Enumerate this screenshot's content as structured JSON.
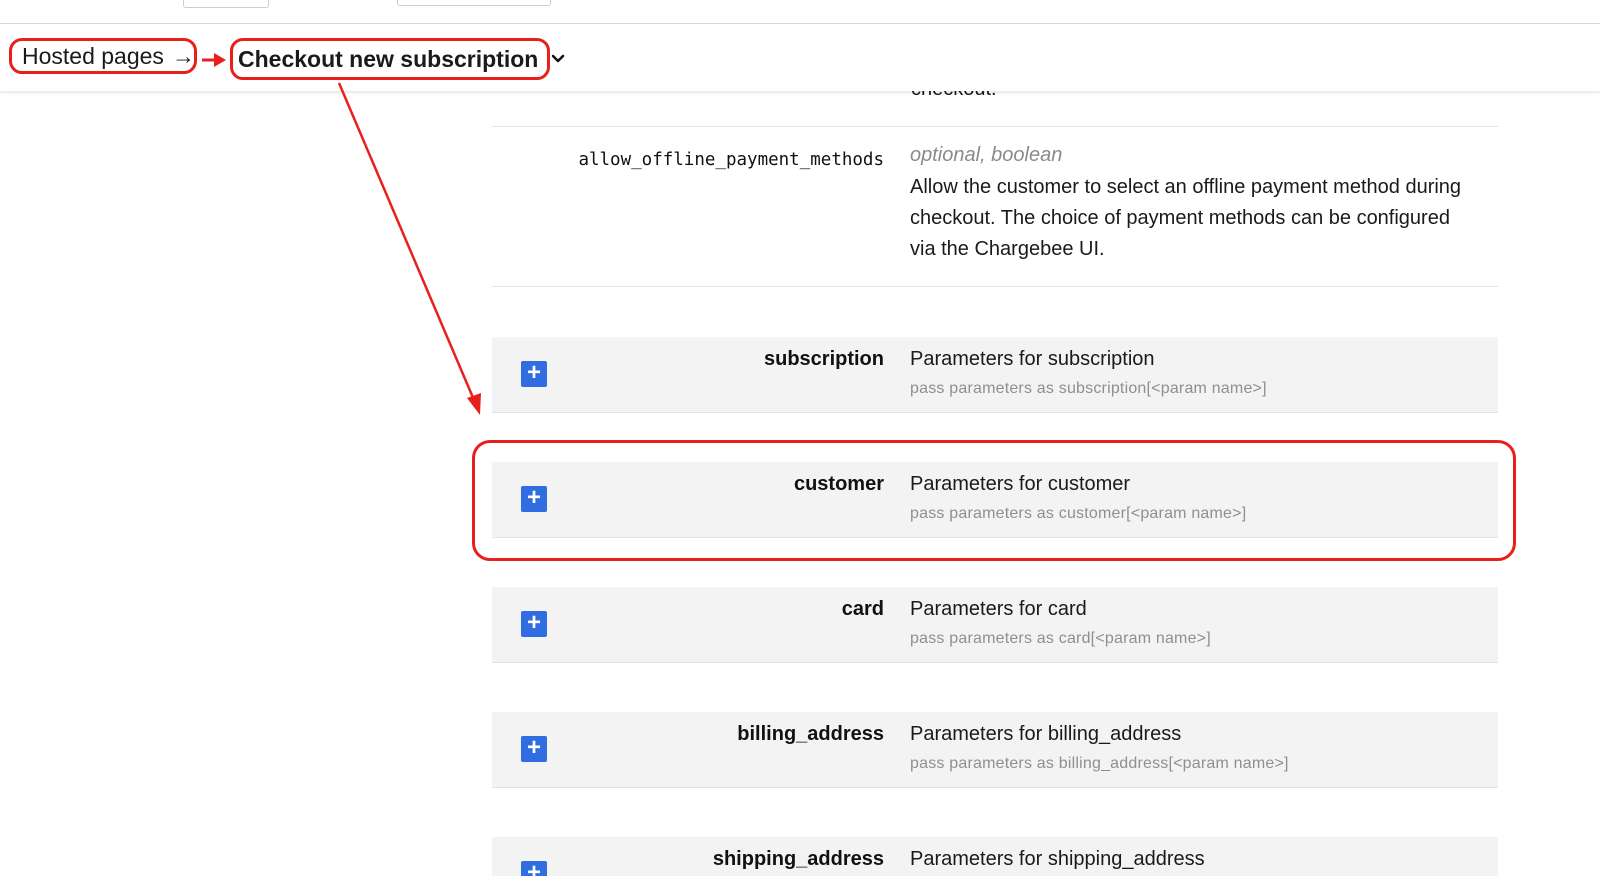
{
  "breadcrumb": {
    "parent_label": "Hosted pages",
    "parent_arrow": "→",
    "current_label": "Checkout new subscription"
  },
  "content": {
    "truncated_text": "checkout.",
    "param": {
      "name": "allow_offline_payment_methods",
      "meta": "optional, boolean",
      "description": "Allow the customer to select an offline payment method during checkout. The choice of payment methods can be configured via the Chargebee UI."
    },
    "groups": [
      {
        "name": "subscription",
        "description": "Parameters for subscription",
        "hint": "pass parameters as subscription[<param name>]"
      },
      {
        "name": "customer",
        "description": "Parameters for customer",
        "hint": "pass parameters as customer[<param name>]"
      },
      {
        "name": "card",
        "description": "Parameters for card",
        "hint": "pass parameters as card[<param name>]"
      },
      {
        "name": "billing_address",
        "description": "Parameters for billing_address",
        "hint": "pass parameters as billing_address[<param name>]"
      },
      {
        "name": "shipping_address",
        "description": "Parameters for shipping_address",
        "hint": ""
      }
    ],
    "expand_symbol": "+"
  },
  "colors": {
    "annotation_red": "#e8201b",
    "expand_button_blue": "#2f6de0",
    "group_background": "#f3f3f3"
  },
  "icons": {
    "breadcrumb_separator": "arrow-right-icon",
    "dropdown": "chevron-down-icon",
    "expand": "plus-icon"
  }
}
